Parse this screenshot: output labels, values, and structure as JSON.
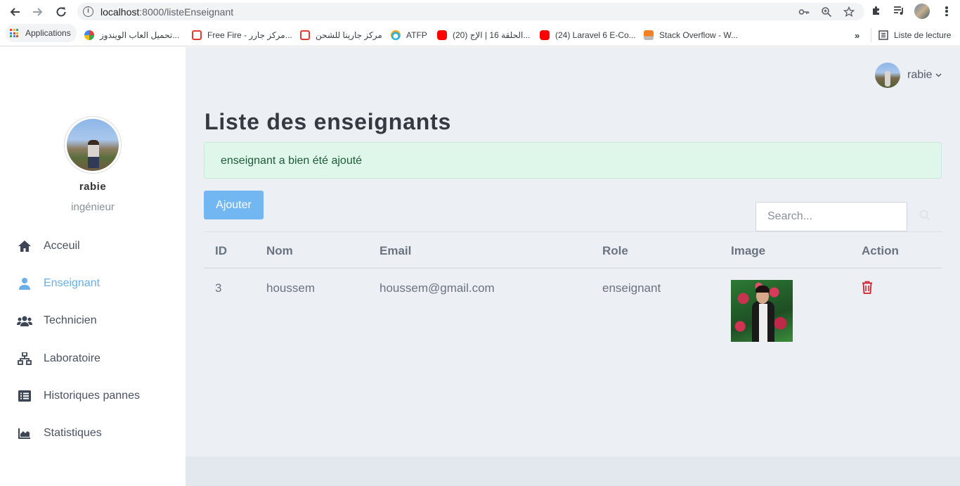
{
  "browser": {
    "url_host": "localhost",
    "url_path": ":8000/listeEnseignant",
    "bookmarks": [
      {
        "label": "Applications",
        "color": "#4285f4"
      },
      {
        "label": "تحميل العاب الويندوز...",
        "color": "#e94235"
      },
      {
        "label": "Free Fire - مركز جارر...",
        "color": "#e53935"
      },
      {
        "label": "مركز جارينا للشحن",
        "color": "#e53935"
      },
      {
        "label": "ATFP",
        "color": "#2bb3e0"
      },
      {
        "label": "(20) الحلقة 16 | الإج...",
        "color": "#ff0000"
      },
      {
        "label": "(24) Laravel 6 E-Co...",
        "color": "#ff0000"
      },
      {
        "label": "Stack Overflow - W...",
        "color": "#f48024"
      }
    ],
    "more_label": "»",
    "reading_list": "Liste de lecture"
  },
  "sidebar": {
    "user_name": "rabie",
    "user_role": "ingénieur",
    "items": [
      {
        "label": "Acceuil",
        "icon": "home-icon",
        "active": false
      },
      {
        "label": "Enseignant",
        "icon": "user-icon",
        "active": true
      },
      {
        "label": "Technicien",
        "icon": "users-icon",
        "active": false
      },
      {
        "label": "Laboratoire",
        "icon": "sitemap-icon",
        "active": false
      },
      {
        "label": "Historiques pannes",
        "icon": "list-icon",
        "active": false
      },
      {
        "label": "Statistiques",
        "icon": "chart-area-icon",
        "active": false
      }
    ]
  },
  "header": {
    "user_name": "rabie",
    "dropdown_icon": "chevron-down-icon"
  },
  "main": {
    "title": "Liste des enseignants",
    "alert": "enseignant a bien été ajouté",
    "add_button": "Ajouter",
    "search_placeholder": "Search...",
    "table": {
      "columns": [
        "ID",
        "Nom",
        "Email",
        "Role",
        "Image",
        "Action"
      ],
      "rows": [
        {
          "id": "3",
          "nom": "houssem",
          "email": "houssem@gmail.com",
          "role": "enseignant"
        }
      ]
    }
  },
  "colors": {
    "accent": "#72b6f2",
    "active_nav": "#6aaee8",
    "alert_bg": "#dff6ea",
    "delete": "#d0212b"
  }
}
